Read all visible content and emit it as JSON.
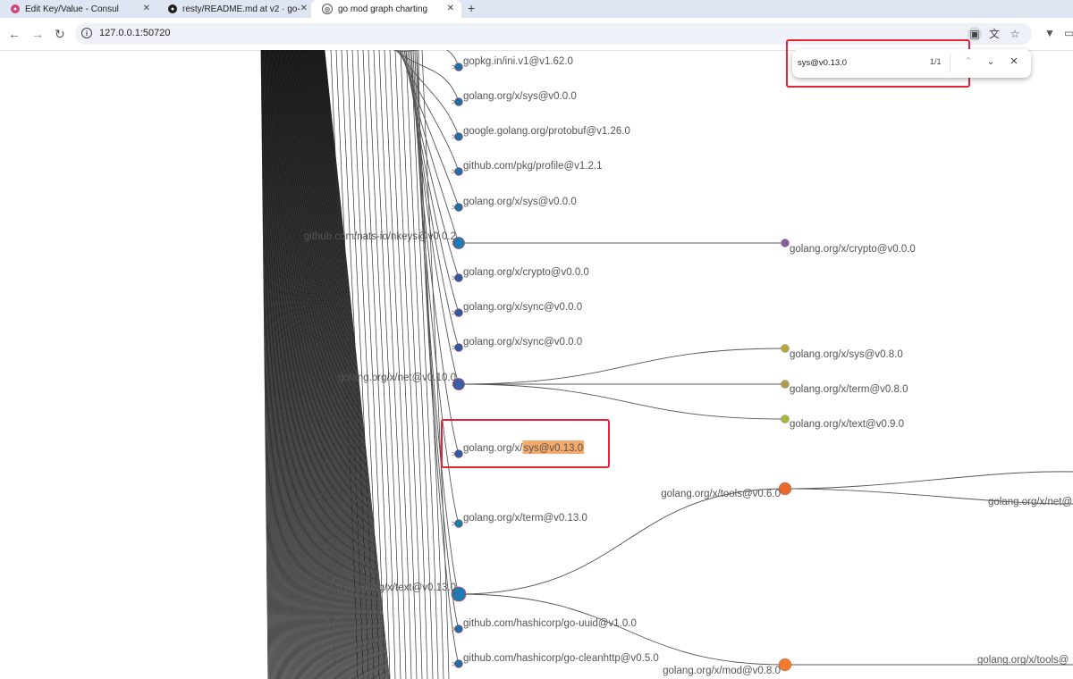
{
  "browser": {
    "tabs": [
      {
        "title": "Edit Key/Value - Consul",
        "icon": "consul-icon",
        "active": false
      },
      {
        "title": "resty/README.md at v2 · go-",
        "icon": "github-icon",
        "active": false
      },
      {
        "title": "go mod graph charting",
        "icon": "globe-icon",
        "active": true
      }
    ],
    "new_tab": "+",
    "url": "127.0.0.1:50720"
  },
  "find_bar": {
    "query": "sys@v0.13.0",
    "count": "1/1"
  },
  "graph": {
    "nodes": [
      {
        "label": "gopkg.in/ini.v1@v1.62.0",
        "color": "#1f6fa3",
        "size": "small"
      },
      {
        "label": "golang.org/x/sys@v0.0.0",
        "color": "#1f6fa3",
        "size": "small"
      },
      {
        "label": "google.golang.org/protobuf@v1.26.0",
        "color": "#1f6fa3",
        "size": "small"
      },
      {
        "label": "github.com/pkg/profile@v1.2.1",
        "color": "#1f6fa3",
        "size": "small"
      },
      {
        "label": "golang.org/x/sys@v0.0.0",
        "color": "#1f6fa3",
        "size": "small"
      },
      {
        "label": "github.com/nats-io/nkeys@v0.0.2",
        "color": "#1f7bb6",
        "size": "medium"
      },
      {
        "label": "golang.org/x/crypto@v0.0.0",
        "color": "#2d5aa0",
        "size": "small"
      },
      {
        "label": "golang.org/x/sync@v0.0.0",
        "color": "#2d5aa0",
        "size": "small"
      },
      {
        "label": "golang.org/x/sync@v0.0.0",
        "color": "#2d5aa0",
        "size": "small"
      },
      {
        "label": "golang.org/x/net@v0.10.0",
        "color": "#3a5ea8",
        "size": "medium"
      },
      {
        "label": "golang.org/x/sys@v0.13.0",
        "color": "#2d5aa0",
        "size": "small",
        "highlight": "sys@v0.13.0"
      },
      {
        "label": "golang.org/x/term@v0.13.0",
        "color": "#1a7ea0",
        "size": "small"
      },
      {
        "label": "golang.org/x/text@v0.13.0",
        "color": "#1f7bb6",
        "size": "large"
      },
      {
        "label": "github.com/hashicorp/go-uuid@v1.0.0",
        "color": "#1f6fa3",
        "size": "small"
      },
      {
        "label": "github.com/hashicorp/go-cleanhttp@v0.5.0",
        "color": "#1f6fa3",
        "size": "small"
      }
    ],
    "children": [
      {
        "label": "golang.org/x/crypto@v0.0.0",
        "color": "#8a5aa6"
      },
      {
        "label": "golang.org/x/sys@v0.8.0",
        "color": "#b9a63a"
      },
      {
        "label": "golang.org/x/term@v0.8.0",
        "color": "#b39a4a"
      },
      {
        "label": "golang.org/x/text@v0.9.0",
        "color": "#a8b636"
      },
      {
        "label": "golang.org/x/tools@v0.6.0",
        "color": "#e9692c"
      },
      {
        "label": "golang.org/x/mod@v0.8.0",
        "color": "#f27a2c"
      }
    ],
    "far_labels": [
      "golang.org/x/net@",
      "golang.org/x/tools@"
    ],
    "link_color": "#555555",
    "highlight_color": "#f5a96a",
    "annotation_color": "#e5243a"
  }
}
